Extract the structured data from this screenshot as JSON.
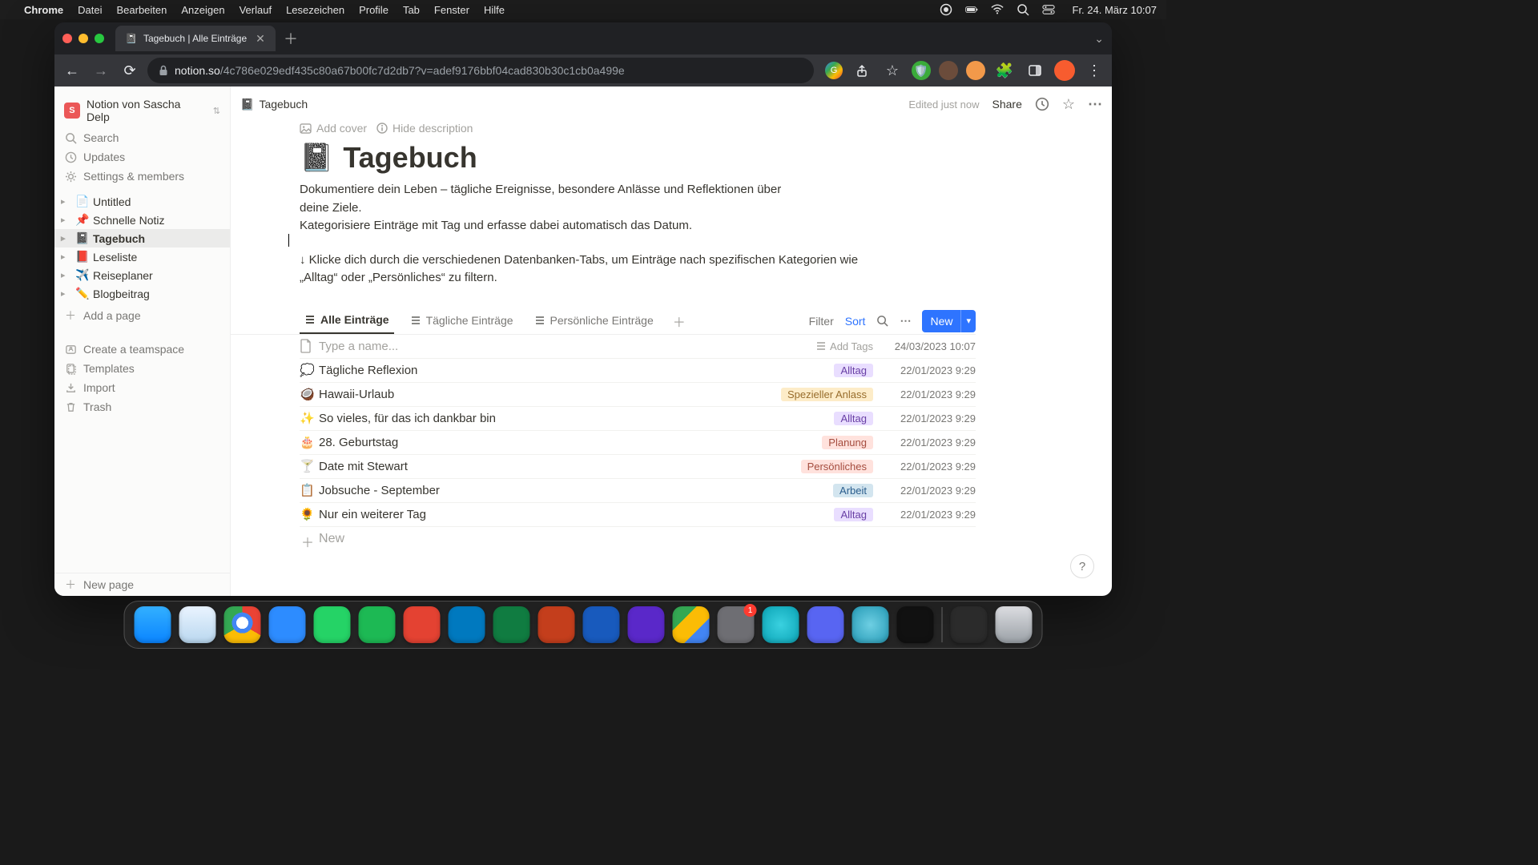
{
  "menubar": {
    "app_name": "Chrome",
    "menus": [
      "Datei",
      "Bearbeiten",
      "Anzeigen",
      "Verlauf",
      "Lesezeichen",
      "Profile",
      "Tab",
      "Fenster",
      "Hilfe"
    ],
    "clock": "Fr. 24. März  10:07"
  },
  "browser": {
    "tab_title": "Tagebuch | Alle Einträge",
    "url_domain": "notion.so",
    "url_path": "/4c786e029edf435c80a67b00fc7d2db7?v=adef9176bbf04cad830b30c1cb0a499e"
  },
  "notion": {
    "workspace_name": "Notion von Sascha Delp",
    "workspace_initial": "S",
    "search_label": "Search",
    "updates_label": "Updates",
    "settings_label": "Settings & members",
    "add_page_label": "Add a page",
    "teamspace_label": "Create a teamspace",
    "templates_label": "Templates",
    "import_label": "Import",
    "trash_label": "Trash",
    "new_page_label": "New page",
    "pages": [
      {
        "emoji": "📄",
        "label": "Untitled",
        "active": false
      },
      {
        "emoji": "📌",
        "label": "Schnelle Notiz",
        "active": false
      },
      {
        "emoji": "📓",
        "label": "Tagebuch",
        "active": true
      },
      {
        "emoji": "📕",
        "label": "Leseliste",
        "active": false
      },
      {
        "emoji": "✈️",
        "label": "Reiseplaner",
        "active": false
      },
      {
        "emoji": "✏️",
        "label": "Blogbeitrag",
        "active": false
      }
    ],
    "breadcrumb_emoji": "📓",
    "breadcrumb_title": "Tagebuch",
    "edited_text": "Edited just now",
    "share_label": "Share",
    "add_cover_label": "Add cover",
    "hide_desc_label": "Hide description",
    "page_icon": "📓",
    "page_title": "Tagebuch",
    "description_line1": "Dokumentiere dein Leben – tägliche Ereignisse, besondere Anlässe und Reflektionen über deine Ziele.",
    "description_line2": "Kategorisiere Einträge mit Tag und erfasse dabei automatisch das Datum.",
    "tip_text": "↓ Klicke dich durch die verschiedenen Datenbanken-Tabs, um Einträge nach spezifischen Kategorien wie „Alltag“ oder „Persönliches“ zu filtern.",
    "views": [
      "Alle Einträge",
      "Tägliche Einträge",
      "Persönliche Einträge"
    ],
    "filter_label": "Filter",
    "sort_label": "Sort",
    "new_label": "New",
    "add_tags_label": "Add Tags",
    "new_row_label": "New",
    "new_entry_placeholder": "Type a name...",
    "new_entry_date": "24/03/2023 10:07",
    "entries": [
      {
        "emoji": "💭",
        "title": "Tägliche Reflexion",
        "tag": "Alltag",
        "tag_bg": "#e9deff",
        "tag_color": "#6940a5",
        "date": "22/01/2023 9:29"
      },
      {
        "emoji": "🥥",
        "title": "Hawaii-Urlaub",
        "tag": "Spezieller Anlass",
        "tag_bg": "#fdecc8",
        "tag_color": "#986d2c",
        "date": "22/01/2023 9:29"
      },
      {
        "emoji": "✨",
        "title": "So vieles, für das ich dankbar bin",
        "tag": "Alltag",
        "tag_bg": "#e9deff",
        "tag_color": "#6940a5",
        "date": "22/01/2023 9:29"
      },
      {
        "emoji": "🎂",
        "title": "28. Geburtstag",
        "tag": "Planung",
        "tag_bg": "#ffe2dd",
        "tag_color": "#a54d3f",
        "date": "22/01/2023 9:29"
      },
      {
        "emoji": "🍸",
        "title": "Date mit Stewart",
        "tag": "Persönliches",
        "tag_bg": "#ffe2dd",
        "tag_color": "#a54d3f",
        "date": "22/01/2023 9:29"
      },
      {
        "emoji": "📋",
        "title": "Jobsuche - September",
        "tag": "Arbeit",
        "tag_bg": "#d3e5ef",
        "tag_color": "#2a5d8d",
        "date": "22/01/2023 9:29"
      },
      {
        "emoji": "🌻",
        "title": "Nur ein weiterer Tag",
        "tag": "Alltag",
        "tag_bg": "#e9deff",
        "tag_color": "#6940a5",
        "date": "22/01/2023 9:29"
      }
    ]
  }
}
